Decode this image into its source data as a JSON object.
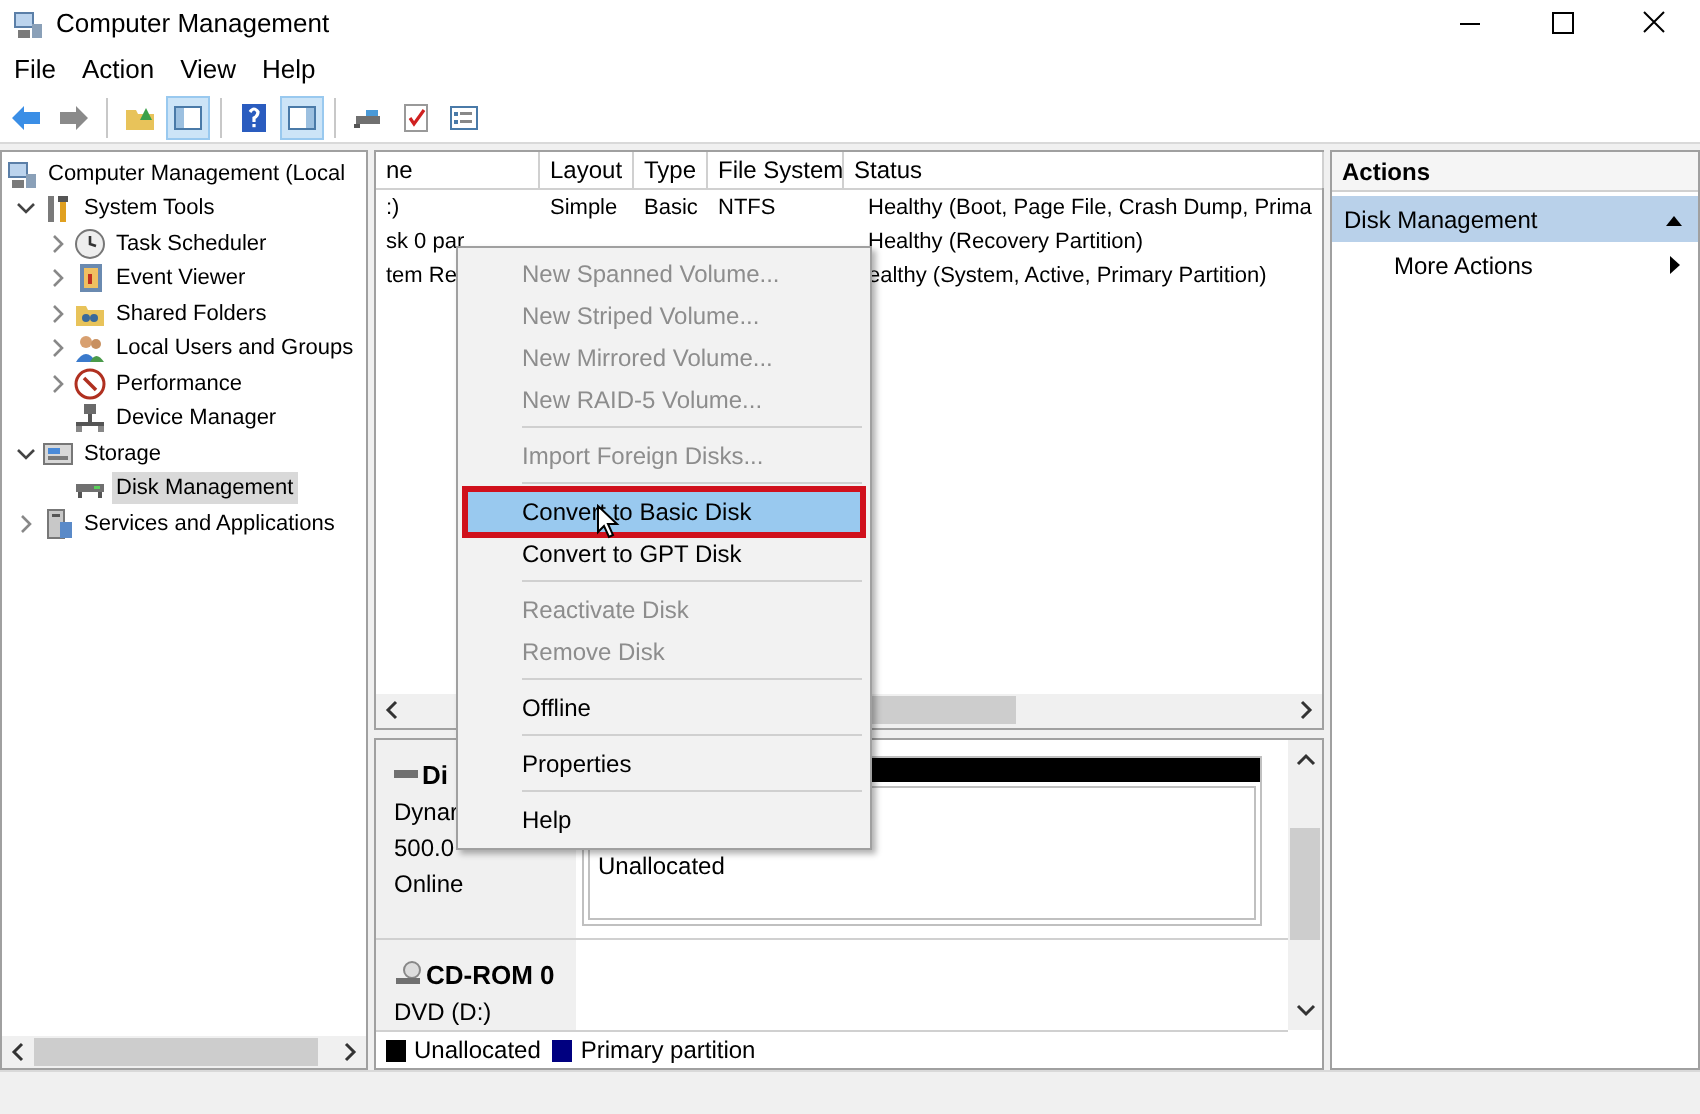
{
  "window": {
    "title": "Computer Management"
  },
  "menu": [
    "File",
    "Action",
    "View",
    "Help"
  ],
  "toolbar": [
    {
      "kind": "back",
      "pressed": false
    },
    {
      "kind": "forward",
      "pressed": false
    },
    {
      "kind": "sep"
    },
    {
      "kind": "folder-up",
      "pressed": false
    },
    {
      "kind": "tree-pane",
      "pressed": true
    },
    {
      "kind": "sep"
    },
    {
      "kind": "help",
      "pressed": false
    },
    {
      "kind": "action-pane",
      "pressed": true
    },
    {
      "kind": "sep"
    },
    {
      "kind": "connect",
      "pressed": false
    },
    {
      "kind": "checklist",
      "pressed": false
    },
    {
      "kind": "properties",
      "pressed": false
    }
  ],
  "tree": [
    {
      "label": "Computer Management (Local",
      "kind": "computer",
      "selected": false,
      "children": [
        {
          "label": "System Tools",
          "kind": "tools",
          "expanded": true,
          "selected": false,
          "children": [
            {
              "label": "Task Scheduler",
              "kind": "clock",
              "expanded": false,
              "selected": false
            },
            {
              "label": "Event Viewer",
              "kind": "log",
              "expanded": false,
              "selected": false
            },
            {
              "label": "Shared Folders",
              "kind": "share",
              "expanded": false,
              "selected": false
            },
            {
              "label": "Local Users and Groups",
              "kind": "users",
              "expanded": false,
              "selected": false
            },
            {
              "label": "Performance",
              "kind": "gauge",
              "expanded": false,
              "selected": false
            },
            {
              "label": "Device Manager",
              "kind": "device",
              "selected": false
            }
          ]
        },
        {
          "label": "Storage",
          "kind": "storage",
          "expanded": true,
          "selected": false,
          "children": [
            {
              "label": "Disk Management",
              "kind": "drive",
              "selected": true
            }
          ]
        },
        {
          "label": "Services and Applications",
          "kind": "services",
          "expanded": false,
          "selected": false
        }
      ]
    }
  ],
  "table": {
    "columns": [
      "ne",
      "Layout",
      "Type",
      "File System",
      "Status"
    ],
    "rows": [
      [
        ":)",
        "Simple",
        "Basic",
        "NTFS",
        "Healthy (Boot, Page File, Crash Dump, Prima"
      ],
      [
        "sk 0 par",
        "",
        "",
        "",
        "Healthy (Recovery Partition)"
      ],
      [
        "tem Re",
        "",
        "",
        "",
        "ealthy (System, Active, Primary Partition)"
      ]
    ]
  },
  "context_menu": [
    {
      "kind": "item",
      "label": "New Spanned Volume...",
      "disabled": true,
      "selected": false,
      "outlined": false
    },
    {
      "kind": "item",
      "label": "New Striped Volume...",
      "disabled": true,
      "selected": false,
      "outlined": false
    },
    {
      "kind": "item",
      "label": "New Mirrored Volume...",
      "disabled": true,
      "selected": false,
      "outlined": false
    },
    {
      "kind": "item",
      "label": "New RAID-5 Volume...",
      "disabled": true,
      "selected": false,
      "outlined": false
    },
    {
      "kind": "separator"
    },
    {
      "kind": "item",
      "label": "Import Foreign Disks...",
      "disabled": true,
      "selected": false,
      "outlined": false
    },
    {
      "kind": "separator"
    },
    {
      "kind": "item",
      "label": "Convert to Basic Disk",
      "disabled": false,
      "selected": true,
      "outlined": true
    },
    {
      "kind": "item",
      "label": "Convert to GPT Disk",
      "disabled": false,
      "selected": false,
      "outlined": false
    },
    {
      "kind": "separator"
    },
    {
      "kind": "item",
      "label": "Reactivate Disk",
      "disabled": true,
      "selected": false,
      "outlined": false
    },
    {
      "kind": "item",
      "label": "Remove Disk",
      "disabled": true,
      "selected": false,
      "outlined": false
    },
    {
      "kind": "separator"
    },
    {
      "kind": "item",
      "label": "Offline",
      "disabled": false,
      "selected": false,
      "outlined": false
    },
    {
      "kind": "separator"
    },
    {
      "kind": "item",
      "label": "Properties",
      "disabled": false,
      "selected": false,
      "outlined": false
    },
    {
      "kind": "separator"
    },
    {
      "kind": "item",
      "label": "Help",
      "disabled": false,
      "selected": false,
      "outlined": false
    }
  ],
  "disks": [
    {
      "kind": "disk",
      "name": "Di",
      "lines": [
        "Dynar",
        "500.0",
        "Online"
      ],
      "partitions": [
        {
          "status": "Unallocated",
          "color": "#000000"
        }
      ]
    },
    {
      "kind": "cdrom",
      "name": "CD-ROM 0",
      "lines": [
        "DVD (D:)"
      ]
    }
  ],
  "legend": [
    {
      "label": "Unallocated",
      "color": "#000000"
    },
    {
      "label": "Primary partition",
      "color": "#000080"
    }
  ],
  "actions": {
    "title": "Actions",
    "sections": [
      {
        "label": "Disk Management",
        "expanded": true,
        "items": [
          "More Actions"
        ]
      }
    ]
  }
}
